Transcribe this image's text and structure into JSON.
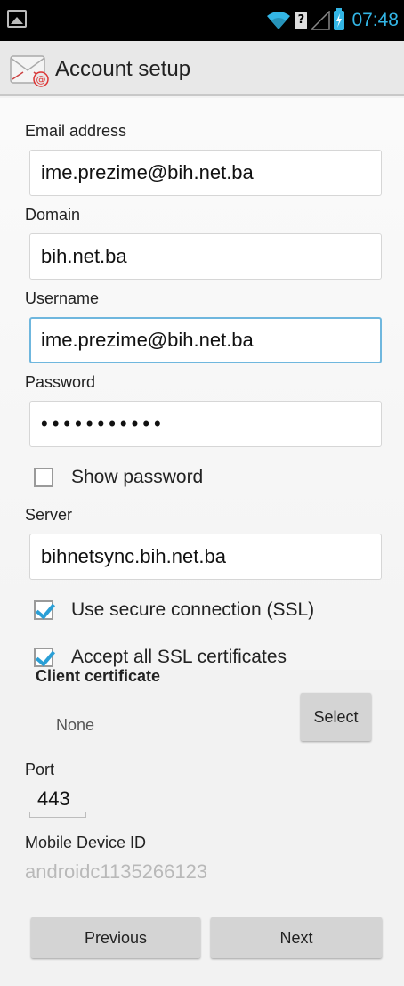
{
  "status_bar": {
    "time": "07:48",
    "icons": [
      "image-icon",
      "wifi-icon",
      "unknown-sim-icon",
      "signal-icon",
      "battery-charging-icon"
    ],
    "accent": "#33b5e5",
    "unknown_sim_glyph": "?"
  },
  "action_bar": {
    "title": "Account setup",
    "icon": "email-app-icon"
  },
  "form": {
    "email": {
      "label": "Email address",
      "value": "ime.prezime@bih.net.ba"
    },
    "domain": {
      "label": "Domain",
      "value": "bih.net.ba"
    },
    "username": {
      "label": "Username",
      "value": "ime.prezime@bih.net.ba"
    },
    "password": {
      "label": "Password",
      "value": "•••••••••••"
    },
    "show_password": {
      "label": "Show password",
      "checked": false
    },
    "server": {
      "label": "Server",
      "value": "bihnetsync.bih.net.ba"
    },
    "ssl": {
      "label": "Use secure connection (SSL)",
      "checked": true
    },
    "accept_certs": {
      "label": "Accept all SSL certificates",
      "checked": true
    },
    "client_certificate": {
      "label": "Client certificate",
      "value": "None",
      "button": "Select"
    },
    "port": {
      "label": "Port",
      "value": "443"
    },
    "device_id": {
      "label": "Mobile Device ID",
      "value": "androidc1135266123"
    }
  },
  "buttons": {
    "previous": "Previous",
    "next": "Next"
  }
}
